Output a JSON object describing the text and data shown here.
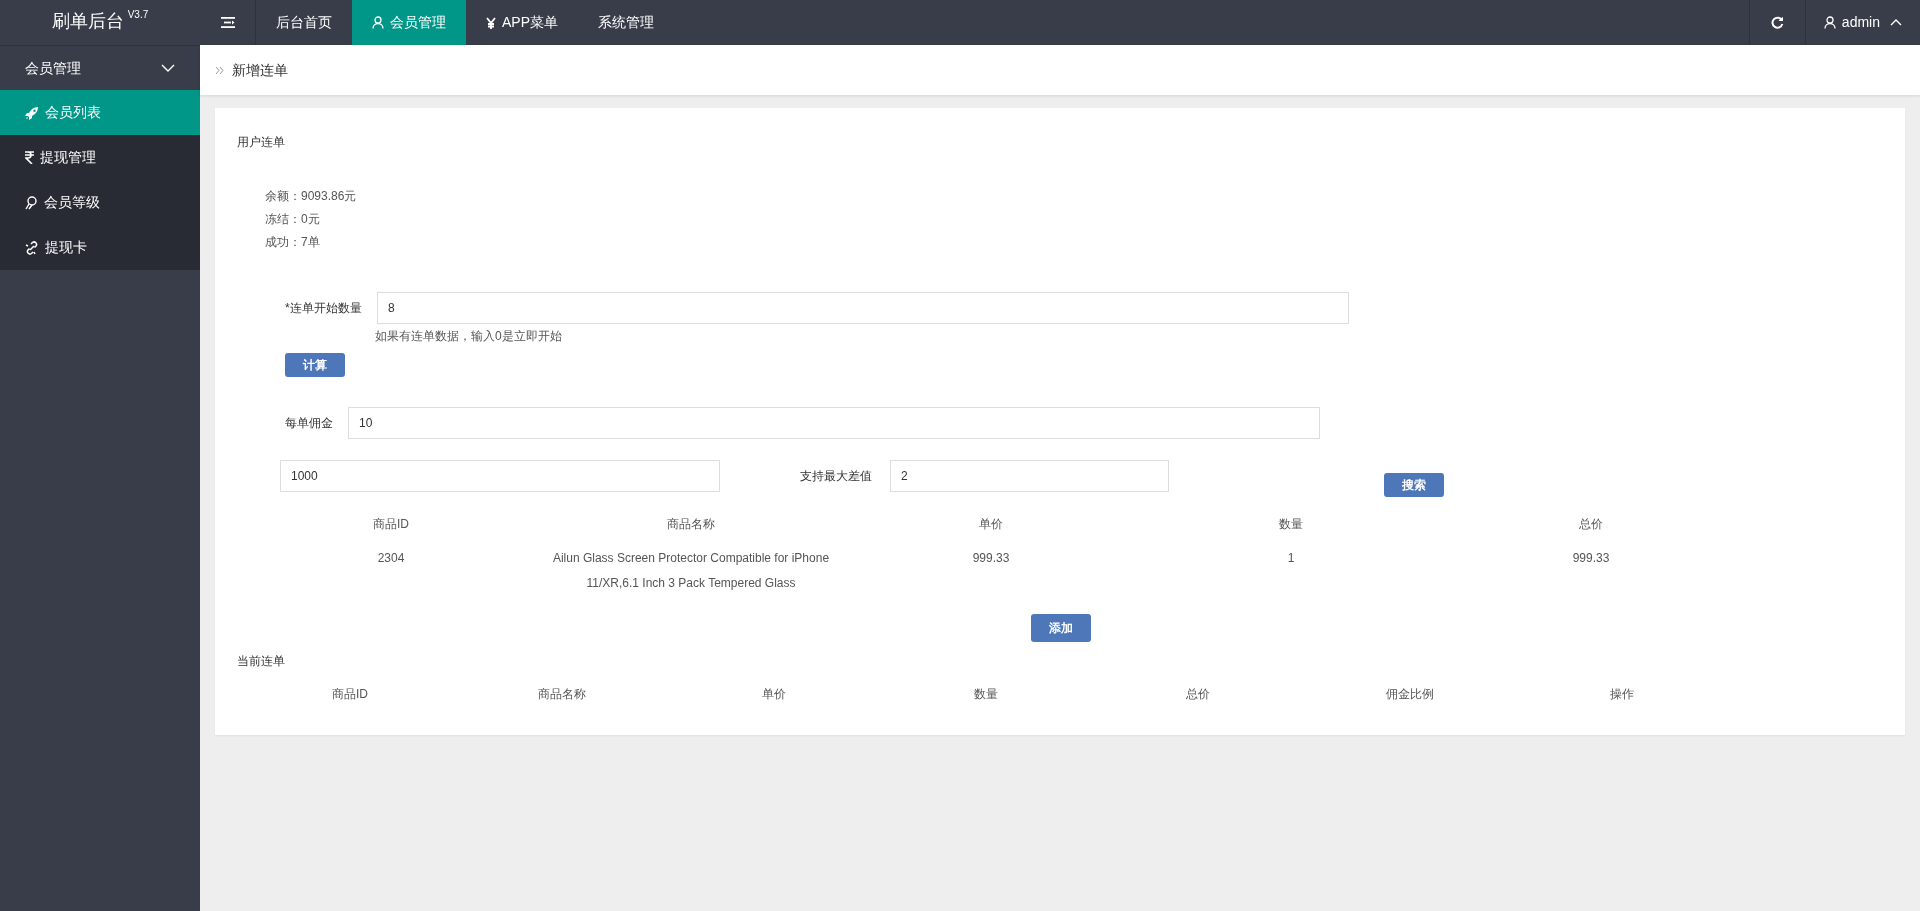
{
  "app": {
    "title": "刷单后台",
    "version": "V3.7"
  },
  "top_nav": [
    {
      "kind": "plain",
      "label": "后台首页",
      "selected": false
    },
    {
      "kind": "user",
      "label": "会员管理",
      "selected": true
    },
    {
      "kind": "yen",
      "label": "APP菜单",
      "selected": false
    },
    {
      "kind": "plain",
      "label": "系统管理",
      "selected": false
    }
  ],
  "user_menu": {
    "label": "admin",
    "expanded": true
  },
  "sidebar": {
    "label": "会员管理",
    "expanded": true,
    "children": [
      {
        "kind": "rocket",
        "label": "会员列表",
        "selected": true
      },
      {
        "kind": "rupee",
        "label": "提现管理",
        "selected": false
      },
      {
        "kind": "medal",
        "label": "会员等级",
        "selected": false
      },
      {
        "kind": "link",
        "label": "提现卡",
        "selected": false
      }
    ]
  },
  "breadcrumb": "新增连单",
  "section_title": "用户连单",
  "stats": [
    "余额：9093.86元",
    "冻结：0元",
    "成功：7单"
  ],
  "start_count": {
    "label": "*连单开始数量",
    "value": "8",
    "hint": "如果有连单数据，输入0是立即开始"
  },
  "calc_button": "计算",
  "commission": {
    "label": "每单佣金",
    "value": "10"
  },
  "amount": {
    "value": "1000"
  },
  "max_diff": {
    "label": "支持最大差值",
    "value": "2"
  },
  "search_button": "搜索",
  "products_table": {
    "columns": [
      "商品ID",
      "商品名称",
      "单价",
      "数量",
      "总价"
    ],
    "rows": [
      [
        "2304",
        "Ailun Glass Screen Protector Compatible for iPhone 11/XR,6.1 Inch 3 Pack Tempered Glass",
        "999.33",
        "1",
        "999.33"
      ]
    ]
  },
  "add_button": "添加",
  "current_title": "当前连单",
  "current_table": {
    "columns": [
      "商品ID",
      "商品名称",
      "单价",
      "数量",
      "总价",
      "佣金比例",
      "操作"
    ]
  }
}
